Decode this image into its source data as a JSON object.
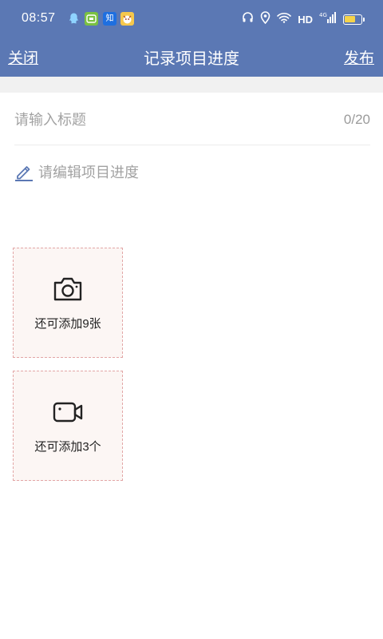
{
  "status_bar": {
    "time": "08:57",
    "notification_icons": [
      "qq-icon",
      "app-icon",
      "zhihu-icon",
      "app-icon"
    ],
    "zhihu_glyph": "知",
    "network_label": "HD",
    "battery_level_percent": 70,
    "battery_fill_color": "#f5d34a"
  },
  "nav": {
    "close_label": "关闭",
    "title": "记录项目进度",
    "publish_label": "发布",
    "background_color": "#5b78b4"
  },
  "form": {
    "title_placeholder": "请输入标题",
    "title_value": "",
    "title_counter": "0/20",
    "content_placeholder": "请编辑项目进度"
  },
  "media": {
    "photo_label": "还可添加9张",
    "video_label": "还可添加3个",
    "border_color": "#e2a6a6"
  }
}
